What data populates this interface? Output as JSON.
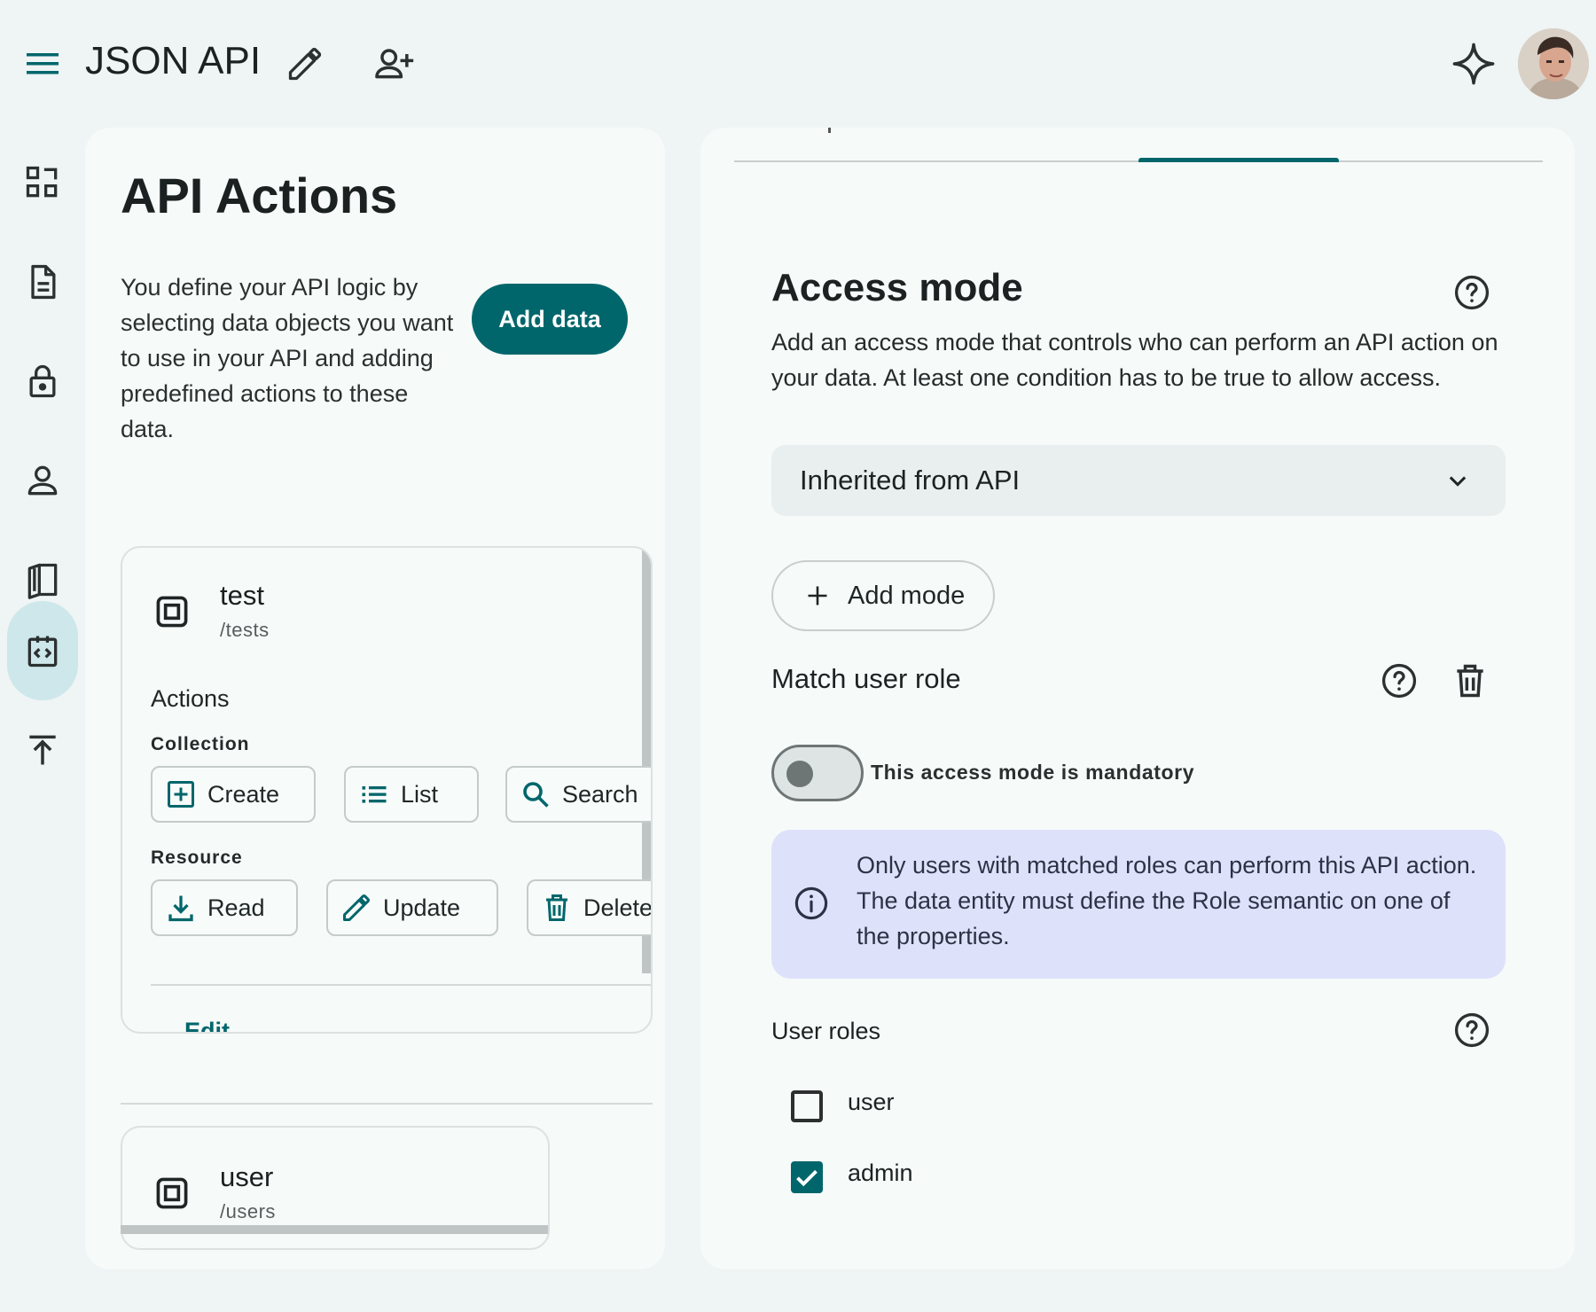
{
  "header": {
    "menu_icon": "menu-icon",
    "app_title": "JSON API",
    "edit_icon": "pencil-icon",
    "share_icon": "add-person-icon",
    "assistant_icon": "sparkle-icon"
  },
  "sidenav": {
    "items": [
      {
        "icon": "dashboard-icon",
        "active": false
      },
      {
        "icon": "document-icon",
        "active": false
      },
      {
        "icon": "lock-icon",
        "active": false
      },
      {
        "icon": "person-icon",
        "active": false
      },
      {
        "icon": "book-icon",
        "active": false
      },
      {
        "icon": "api-code-icon",
        "active": true
      },
      {
        "icon": "publish-icon",
        "active": false
      }
    ]
  },
  "left": {
    "title": "API Actions",
    "intro": "You define your API logic by selecting data objects you want to use in your API and adding predefined actions to these data.",
    "add_data_label": "Add data",
    "cards": [
      {
        "name": "test",
        "path": "/tests",
        "actions_label": "Actions",
        "collection_label": "Collection",
        "collection_actions": [
          "Create",
          "List",
          "Search"
        ],
        "resource_label": "Resource",
        "resource_actions": [
          "Read",
          "Update",
          "Delete"
        ],
        "edit_label": "Edit"
      },
      {
        "name": "user",
        "path": "/users"
      }
    ]
  },
  "right": {
    "access_title": "Access mode",
    "access_desc": "Add an access mode that controls who can perform an API action on your data. At least one condition has to be true to allow access.",
    "select_value": "Inherited from API",
    "add_mode_label": "Add mode",
    "match_title": "Match user role",
    "mandatory_label": "This access mode is mandatory",
    "mandatory_on": false,
    "info_text": "Only users with matched roles can perform this API action. The data entity must define the Role semantic on one of the properties.",
    "roles_title": "User roles",
    "roles": [
      {
        "label": "user",
        "checked": false
      },
      {
        "label": "admin",
        "checked": true
      }
    ]
  },
  "colors": {
    "accent": "#00666b",
    "background": "#eff4f4",
    "panel": "#f6faf9",
    "info_background": "#dee1fa",
    "nav_active": "#cde7ea"
  }
}
